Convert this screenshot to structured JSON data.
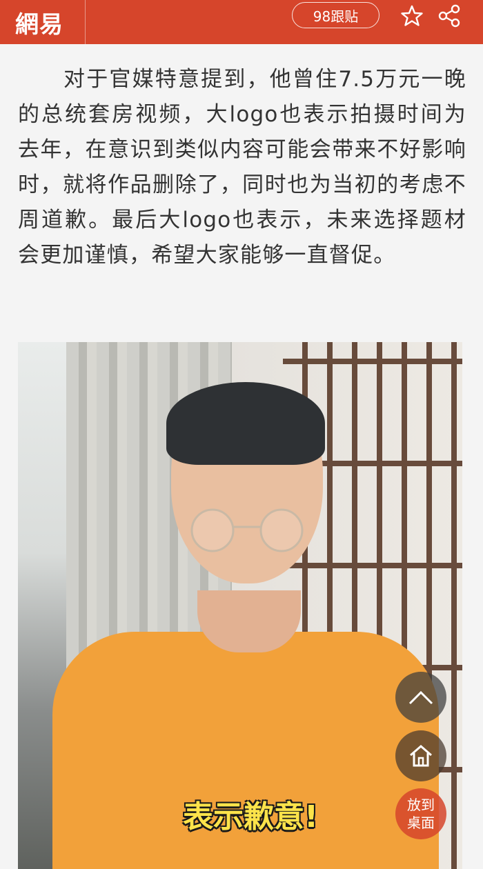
{
  "header": {
    "logo_text": "網易",
    "comment_count_label": "98跟贴",
    "icons": [
      "star-icon",
      "share-icon"
    ],
    "brand_color": "#d6452b"
  },
  "article": {
    "paragraph": "对于官媒特意提到，他曾住7.5万元一晚的总统套房视频，大logo也表示拍摄时间为去年，在意识到类似内容可能会带来不好影响时，就将作品删除了，同时也为当初的考虑不周道歉。最后大logo也表示，未来选择题材会更加谨慎，希望大家能够一直督促。"
  },
  "video": {
    "caption": "表示歉意!"
  },
  "floating_buttons": {
    "scroll_top_icon": "chevron-up-icon",
    "home_icon": "home-icon",
    "desktop_label": "放到桌面",
    "desktop_label_line1": "放到",
    "desktop_label_line2": "桌面"
  }
}
